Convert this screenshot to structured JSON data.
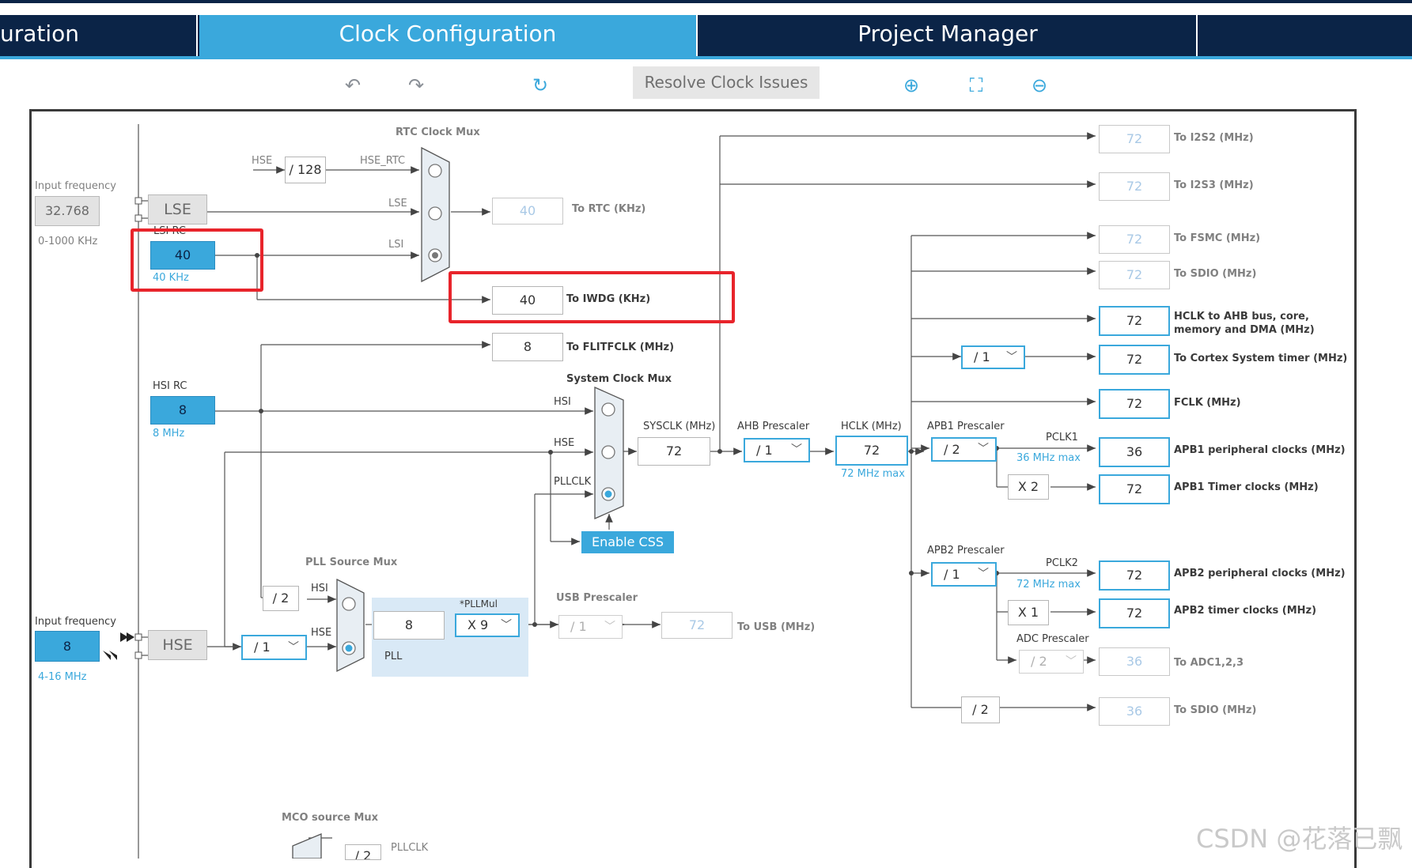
{
  "tabs": [
    {
      "label": "uration",
      "active": false
    },
    {
      "label": "Clock Configuration",
      "active": true
    },
    {
      "label": "Project Manager",
      "active": false
    }
  ],
  "toolbar": {
    "resolve_label": "Resolve Clock Issues"
  },
  "left": {
    "input_freq_label_top": "Input frequency",
    "lse_input_value": "32.768",
    "lse_range": "0-1000 KHz",
    "lse_label": "LSE",
    "lsi_rc_label": "LSI RC",
    "lsi_value": "40",
    "lsi_khz": "40 KHz",
    "hsi_rc_label": "HSI RC",
    "hsi_value": "8",
    "hsi_mhz": "8 MHz",
    "input_freq_label_bottom": "Input frequency",
    "hse_input_value": "8",
    "hse_range": "4-16 MHz",
    "hse_label": "HSE"
  },
  "rtc": {
    "title": "RTC Clock Mux",
    "hse_label": "HSE",
    "div128": "/ 128",
    "hse_rtc": "HSE_RTC",
    "lse_in": "LSE",
    "lsi_in": "LSI",
    "to_rtc_value": "40",
    "to_rtc_label": "To RTC (KHz)",
    "to_iwdg_value": "40",
    "to_iwdg_label": "To IWDG (KHz)",
    "flit_value": "8",
    "flit_label": "To FLITFCLK (MHz)"
  },
  "sysmux": {
    "title": "System Clock Mux",
    "hsi": "HSI",
    "hse": "HSE",
    "pllclk": "PLLCLK",
    "enable_css": "Enable CSS"
  },
  "pll": {
    "source_title": "PLL Source Mux",
    "div2": "/ 2",
    "hsi": "HSI",
    "hse": "HSE",
    "hse_div": "/ 1",
    "pll_value": "8",
    "pll_label": "PLL",
    "pllmul_label": "*PLLMul",
    "pllmul_value": "X 9"
  },
  "usb": {
    "title": "USB Prescaler",
    "div": "/ 1",
    "value": "72",
    "label": "To USB (MHz)"
  },
  "core": {
    "sysclk_label": "SYSCLK (MHz)",
    "sysclk_value": "72",
    "ahb_label": "AHB Prescaler",
    "ahb_value": "/ 1",
    "hclk_label": "HCLK (MHz)",
    "hclk_value": "72",
    "hclk_max": "72 MHz max"
  },
  "apb1": {
    "label": "APB1 Prescaler",
    "value": "/ 2",
    "pclk": "PCLK1",
    "max": "36 MHz max",
    "mult": "X 2"
  },
  "apb2": {
    "label": "APB2 Prescaler",
    "value": "/ 1",
    "pclk": "PCLK2",
    "max": "72 MHz max",
    "mult": "X 1",
    "adc_label": "ADC Prescaler",
    "adc_value": "/ 2"
  },
  "cortex_div": "/ 1",
  "sdio_div": "/ 2",
  "outputs": [
    {
      "value": "72",
      "label": "To I2S2 (MHz)"
    },
    {
      "value": "72",
      "label": "To I2S3 (MHz)"
    },
    {
      "value": "72",
      "label": "To FSMC (MHz)"
    },
    {
      "value": "72",
      "label": "To SDIO (MHz)"
    },
    {
      "value": "72",
      "label": "HCLK to AHB bus, core, memory and DMA (MHz)"
    },
    {
      "value": "72",
      "label": "To Cortex System timer (MHz)"
    },
    {
      "value": "72",
      "label": "FCLK (MHz)"
    },
    {
      "value": "36",
      "label": "APB1 peripheral clocks (MHz)"
    },
    {
      "value": "72",
      "label": "APB1 Timer clocks (MHz)"
    },
    {
      "value": "72",
      "label": "APB2 peripheral clocks (MHz)"
    },
    {
      "value": "72",
      "label": "APB2 timer clocks (MHz)"
    },
    {
      "value": "36",
      "label": "To ADC1,2,3"
    },
    {
      "value": "36",
      "label": "To SDIO (MHz)"
    }
  ],
  "mco": {
    "title": "MCO source Mux",
    "div": "/ 2",
    "pllclk": "PLLCLK"
  },
  "watermark": "CSDN @花落已飘",
  "colors": {
    "accent": "#3aa8dc",
    "navy": "#0b2447",
    "highlight": "#e8242b"
  }
}
